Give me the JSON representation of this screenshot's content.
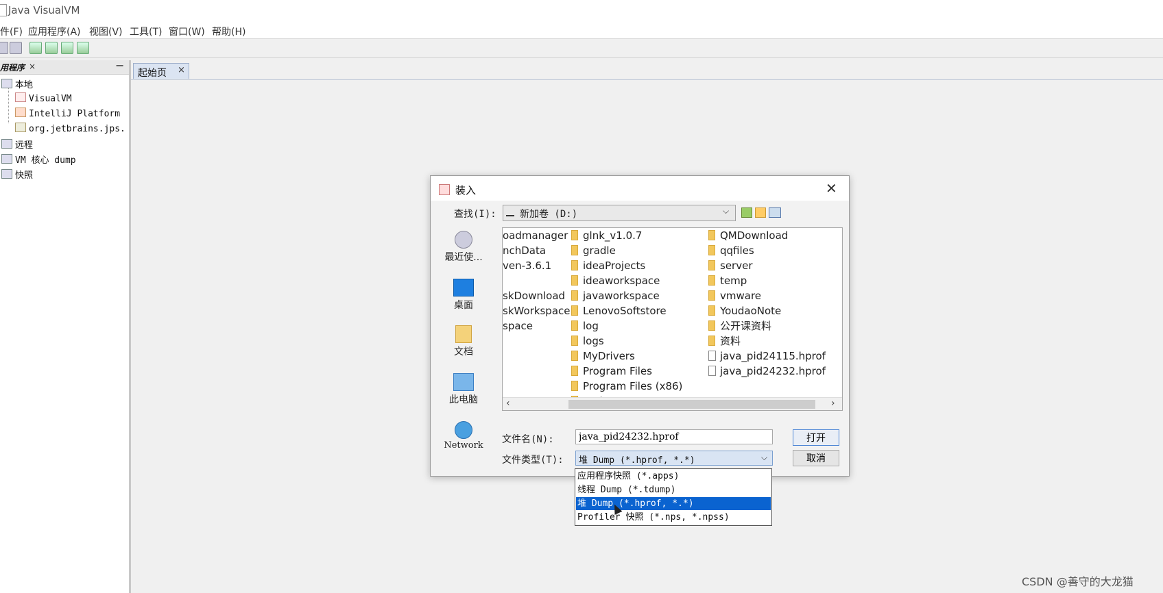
{
  "window": {
    "title": "Java VisualVM"
  },
  "menu": [
    "件(F)",
    "应用程序(A)",
    "视图(V)",
    "工具(T)",
    "窗口(W)",
    "帮助(H)"
  ],
  "left_panel": {
    "tab_label": "用程序",
    "close": "×",
    "minimize": "−",
    "tree": {
      "local": "本地",
      "local_children": [
        "VisualVM",
        "IntelliJ Platform",
        "org.jetbrains.jps."
      ],
      "remote": "远程",
      "coredump": "VM 核心 dump",
      "snapshots": "快照"
    }
  },
  "main": {
    "tab_label": "起始页",
    "tab_close": "×"
  },
  "dialog": {
    "title": "装入",
    "close": "✕",
    "lookin_label": "查找(I):",
    "lookin_value": "新加卷 (D:)",
    "places": [
      "最近使...",
      "桌面",
      "文档",
      "此电脑",
      "Network"
    ],
    "columns": {
      "col1": [
        "oadmanager",
        "nchData",
        "ven-3.6.1",
        "",
        "skDownload",
        "skWorkspace",
        "space",
        "",
        ""
      ],
      "col2": [
        "glnk_v1.0.7",
        "gradle",
        "ideaProjects",
        "ideaworkspace",
        "javaworkspace",
        "LenovoSoftstore",
        "log",
        "logs",
        "MyDrivers",
        "Program Files",
        "Program Files (x86)",
        "project"
      ],
      "col3_folders": [
        "QMDownload",
        "qqfiles",
        "server",
        "temp",
        "vmware",
        "YoudaoNote",
        "公开课资料",
        "资料"
      ],
      "col3_files": [
        "java_pid24115.hprof",
        "java_pid24232.hprof"
      ]
    },
    "filename_label": "文件名(N):",
    "filename_value": "java_pid24232.hprof",
    "filetype_label": "文件类型(T):",
    "filetype_value": "堆 Dump (*.hprof, *.*)",
    "open_label": "打开",
    "cancel_label": "取消",
    "filetype_options": [
      "应用程序快照 (*.apps)",
      "线程 Dump (*.tdump)",
      "堆 Dump (*.hprof, *.*)",
      "Profiler 快照 (*.nps, *.npss)"
    ],
    "selected_option_index": 2
  },
  "watermark": "CSDN @善守的大龙猫"
}
